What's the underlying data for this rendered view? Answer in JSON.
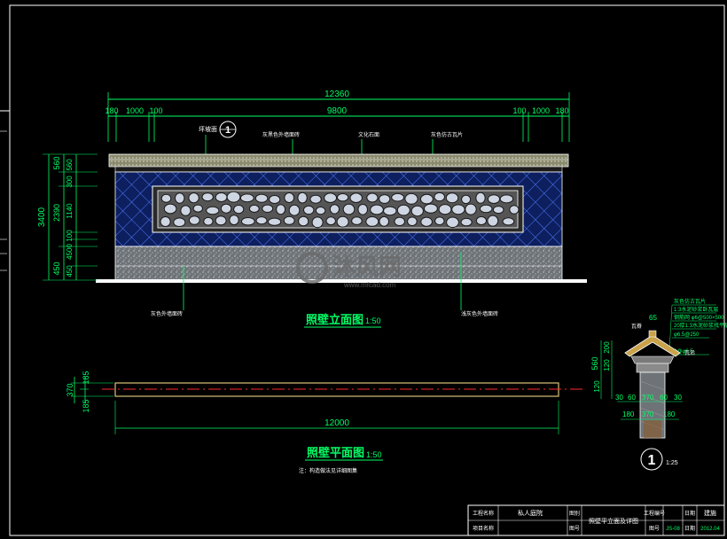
{
  "colors": {
    "background": "#000000",
    "frame": "#ffffff",
    "dimension": "#00ff66",
    "title": "#00ff66",
    "annotation": "#ffffff",
    "leader": "#00ff66",
    "wall_panel": "#1c3fa8",
    "stone_carving": "#cfd6e3",
    "base_granite": "#9aa0a6",
    "centerline": "#ff2a2a",
    "plan_fill": "#d8c27a",
    "watermark": "#5a5a5a"
  },
  "elevation": {
    "title": "照壁立面图",
    "scale": "1:50",
    "dims_top": {
      "overall": "12360",
      "left_180": "180",
      "left_1000": "1000",
      "left_100": "100",
      "middle": "9800",
      "right_100": "100",
      "right_1000": "1000",
      "right_180": "180"
    },
    "dims_left": {
      "total": "3400",
      "top_560": "560",
      "sub_300": "300",
      "sub_560": "560",
      "mid_2390": "2390",
      "panel_1140": "1140",
      "sub_100": "100",
      "sub_4500": "4500",
      "sub_300b": "300",
      "base_450a": "450",
      "base_450b": "450"
    },
    "callout_1": "1",
    "labels": {
      "cap": "坪坡面",
      "top_a": "灰黑色外墙面砖",
      "top_b": "文化石面",
      "top_c": "灰色仿古瓦片",
      "bottom_a": "灰色外墙面砖",
      "bottom_b": "浅灰色外墙面砖"
    }
  },
  "plan": {
    "title": "照壁平面图",
    "scale": "1:50",
    "dim_width": "370",
    "dim_top": "185",
    "dim_bottom": "185",
    "length": "12000",
    "note": "注：构造做法见详细图集"
  },
  "section": {
    "callout": "1",
    "scale": "1:25",
    "dims": {
      "top": "65",
      "h560": "560",
      "h200": "200",
      "h120": "120",
      "w30_left": "30",
      "w60": "60",
      "w370_mid": "370",
      "w60_right": "60",
      "w30_right": "30",
      "b180_left": "180",
      "b370": "370",
      "b180_right": "180",
      "h120_base": "120"
    },
    "labels": {
      "ridge": "瓦脊",
      "ridge_r": "瓦沿",
      "spec_title": "灰色仿古瓦片",
      "spec_1": "1:3水泥砂浆卧瓦层",
      "spec_2": "钢筋网 φ6@500×500",
      "spec_3": "20厚1:3水泥砂浆找平层",
      "spec_4": "φ6.5@250",
      "spec_5": "8@φ6.5"
    }
  },
  "title_block": {
    "c1_label": "工程名称",
    "c2_label": "项目名称",
    "project": "私人庭院",
    "c4a": "图别",
    "c4b": "图号",
    "drawing_name": "照壁平立面及详图",
    "c6a": "工程编号",
    "c6b": "图号",
    "code": "JS-08",
    "c8a": "日期",
    "c8b": "日期",
    "c9a": "建施",
    "c9b": "2012.04"
  },
  "watermark": {
    "text": "沐风网",
    "url": "www.mfcad.com"
  }
}
